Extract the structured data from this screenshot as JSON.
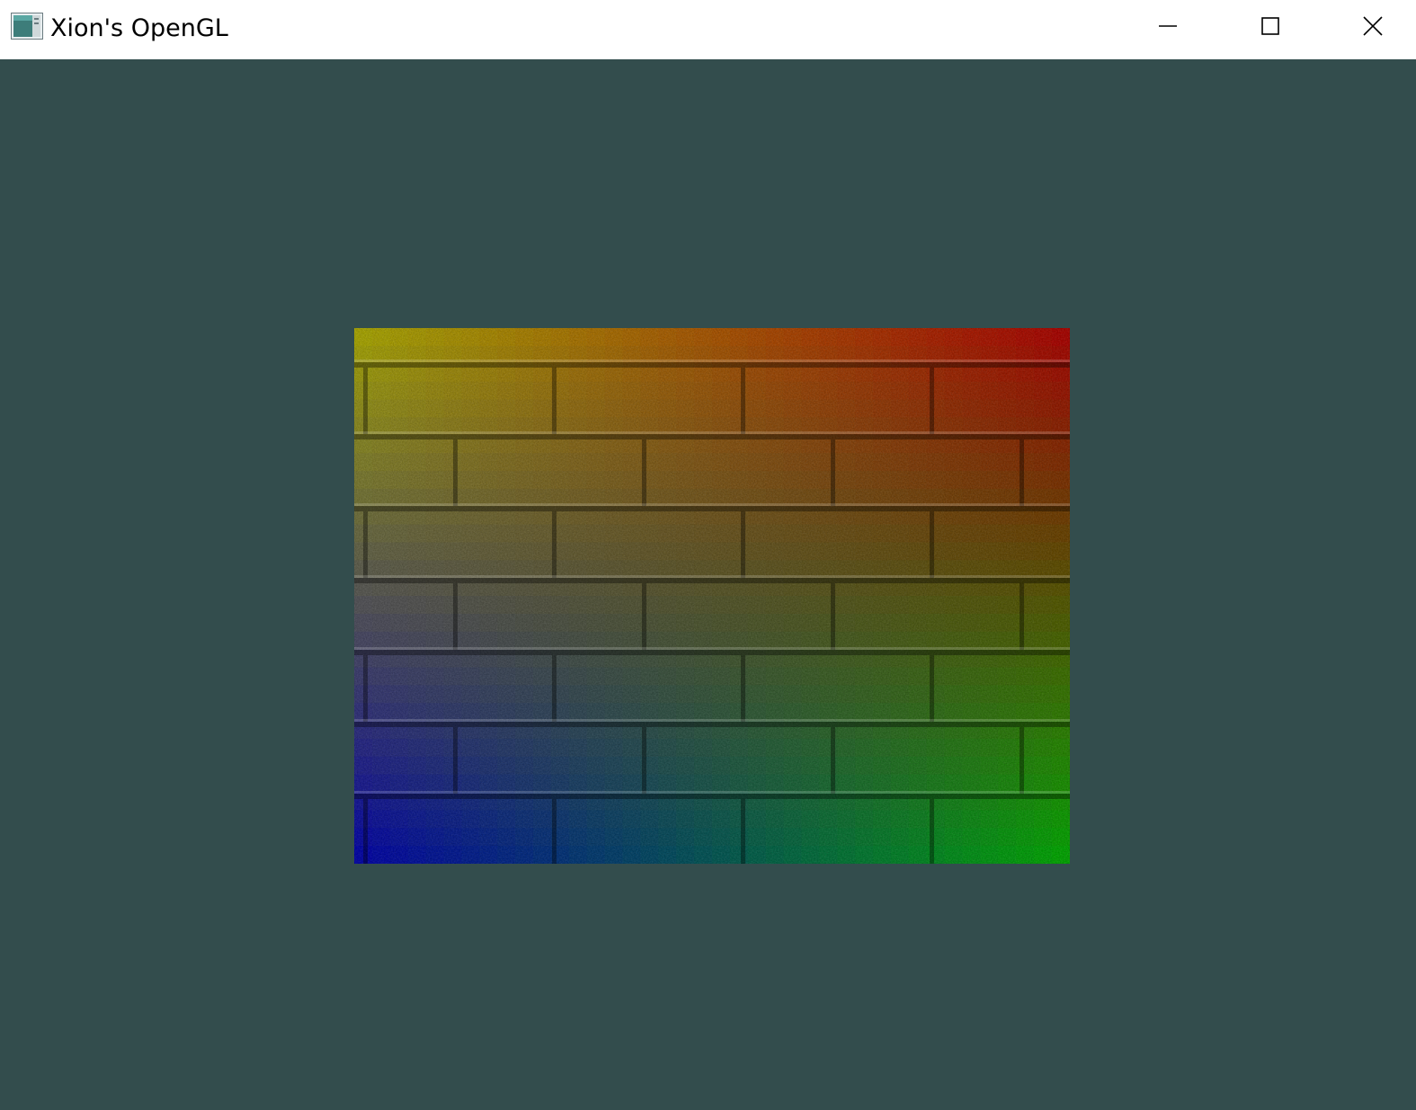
{
  "window": {
    "title": "Xion's OpenGL",
    "app_icon": "opengl-app-icon",
    "controls": {
      "minimize_icon": "minimize-icon",
      "maximize_icon": "maximize-icon",
      "close_icon": "close-icon"
    }
  },
  "viewport": {
    "clear_color": "#334d4d",
    "quad": {
      "texture": "brick-wall-texture",
      "vertex_colors": {
        "top_left": "#ffff00",
        "top_right": "#ff0000",
        "bottom_left": "#0000ff",
        "bottom_right": "#00ff00"
      }
    }
  }
}
